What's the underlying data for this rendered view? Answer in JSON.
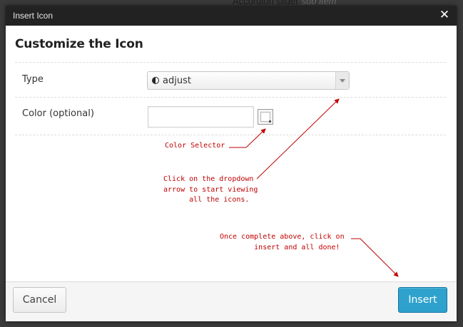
{
  "backdrop": {
    "text": "Accordion slider",
    "sub": "sub item"
  },
  "window": {
    "title": "Insert Icon",
    "close_glyph": "✕"
  },
  "heading": "Customize the Icon",
  "fields": {
    "type": {
      "label": "Type",
      "selected": "adjust",
      "icon": "adjust-icon"
    },
    "color": {
      "label": "Color (optional)",
      "value": "",
      "placeholder": ""
    }
  },
  "annotations": {
    "color_selector": "Color Selector",
    "dropdown_help": "Click on the dropdown\narrow to start viewing\n      all the icons.",
    "insert_help": "Once complete above, click on\n        insert and all done!"
  },
  "buttons": {
    "cancel": "Cancel",
    "insert": "Insert"
  },
  "colors": {
    "annotation": "#c00000",
    "primary_button": "#2ea2cc",
    "titlebar": "#222222"
  }
}
